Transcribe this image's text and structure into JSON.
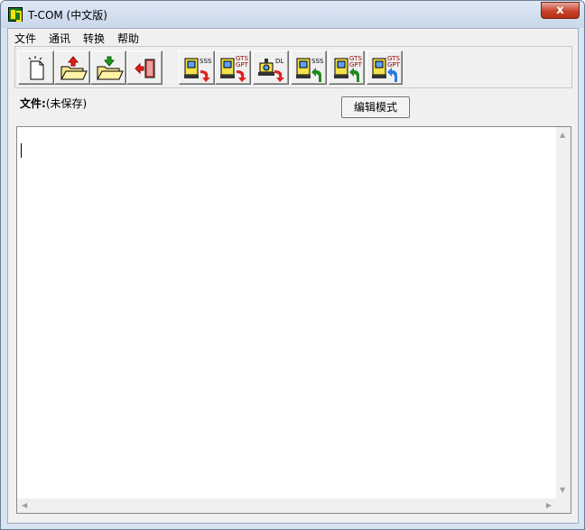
{
  "window": {
    "title": "T-COM (中文版)",
    "close_label": "x"
  },
  "menu": {
    "items": [
      "文件",
      "通讯",
      "转换",
      "帮助"
    ]
  },
  "toolbar": {
    "buttons": [
      {
        "icon": "new-file-icon"
      },
      {
        "icon": "open-upload-icon"
      },
      {
        "icon": "open-download-icon"
      },
      {
        "icon": "exit-icon"
      },
      {
        "icon": "instrument-sss-send-icon",
        "tag": "SSS"
      },
      {
        "icon": "instrument-gts-gpt-send-icon",
        "tag": "GTS GPT"
      },
      {
        "icon": "instrument-dl-send-icon",
        "tag": "DL"
      },
      {
        "icon": "instrument-sss-receive-icon",
        "tag": "SSS"
      },
      {
        "icon": "instrument-gts-gpt-receive-icon",
        "tag": "GTS GPT"
      },
      {
        "icon": "instrument-gts-gpt-receive-blue-icon",
        "tag": "GTS GPT"
      }
    ]
  },
  "status": {
    "file_label": "文件:",
    "file_value": "(未保存)"
  },
  "mode_button": {
    "label": "编辑模式"
  },
  "editor": {
    "content": ""
  },
  "colors": {
    "title_bg": "#c8d7ea",
    "close_red": "#c7432b",
    "client_bg": "#f0f0f0"
  }
}
